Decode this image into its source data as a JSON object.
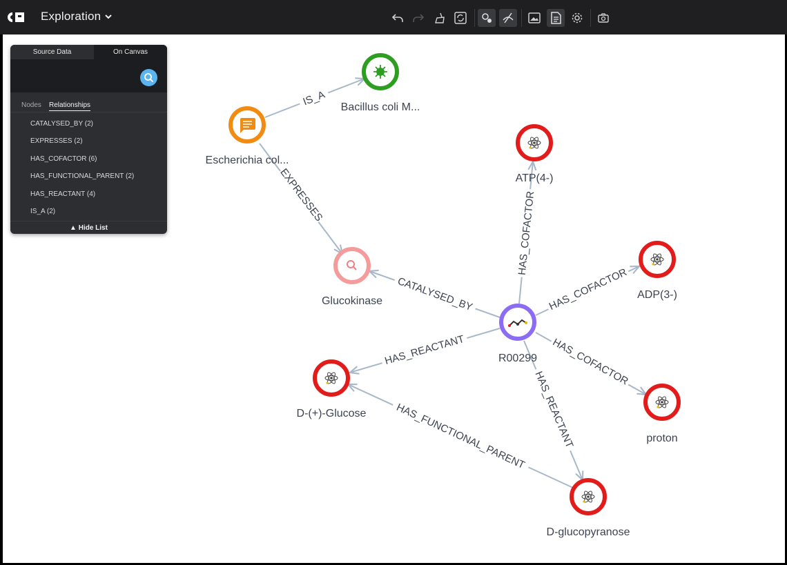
{
  "app": {
    "title": "Exploration"
  },
  "toolbar": {
    "buttons": [
      "undo-icon",
      "redo-icon",
      "clear-canvas-icon",
      "refresh-icon",
      "show-nodes-icon",
      "hide-nodes-icon",
      "image-view-icon",
      "detail-panel-icon",
      "settings-icon",
      "camera-icon"
    ]
  },
  "panel": {
    "tab_source": "Source Data",
    "tab_canvas": "On Canvas",
    "subtab_nodes": "Nodes",
    "subtab_relationships": "Relationships",
    "relationships": [
      "CATALYSED_BY (2)",
      "EXPRESSES (2)",
      "HAS_COFACTOR (6)",
      "HAS_FUNCTIONAL_PARENT (2)",
      "HAS_REACTANT (4)",
      "IS_A (2)"
    ],
    "hide_list": "▲ Hide List"
  },
  "graph": {
    "nodes": {
      "bacillus": "Bacillus coli M...",
      "escherichia": "Escherichia col...",
      "atp": "ATP(4-)",
      "adp": "ADP(3-)",
      "glucokinase": "Glucokinase",
      "r00299": "R00299",
      "glucose": "D-(+)-Glucose",
      "proton": "proton",
      "glucopyranose": "D-glucopyranose"
    },
    "edges": {
      "is_a": "IS_A",
      "expresses": "EXPRESSES",
      "has_cofactor_atp": "HAS_COFACTOR",
      "has_cofactor_adp": "HAS_COFACTOR",
      "has_cofactor_proton": "HAS_COFACTOR",
      "catalysed_by": "CATALYSED_BY",
      "has_reactant_glucose": "HAS_REACTANT",
      "has_reactant_glucopyranose": "HAS_REACTANT",
      "has_functional_parent": "HAS_FUNCTIONAL_PARENT"
    },
    "colors": {
      "organism": "#2e9e23",
      "text_node": "#f28b12",
      "molecule": "#e21b1b",
      "protein": "#f49c9c",
      "reaction": "#8c6cf4",
      "edge": "#a8b8c8"
    }
  }
}
